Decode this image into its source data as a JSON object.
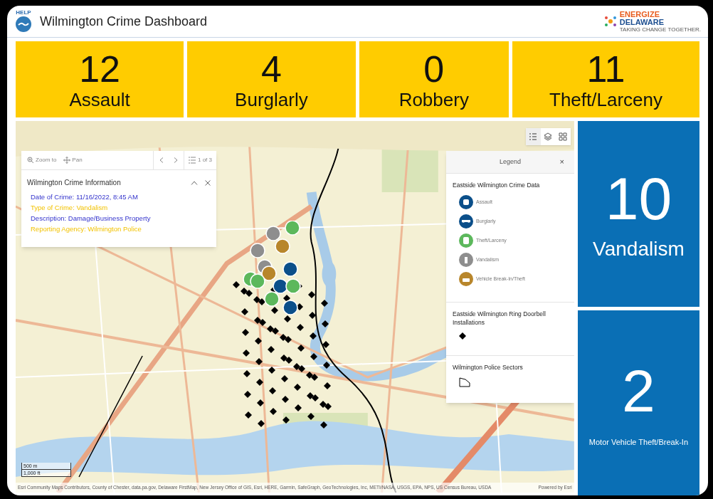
{
  "header": {
    "logo_text": "HELP",
    "title": "Wilmington Crime Dashboard",
    "brand": {
      "line1": "ENERGIZE",
      "line2": "DELAWARE",
      "tagline": "TAKING CHANGE TOGETHER."
    }
  },
  "top_tiles": [
    {
      "count": "12",
      "label": "Assault",
      "color": "#ffcc00"
    },
    {
      "count": "4",
      "label": "Burglarly",
      "color": "#ffcc00"
    },
    {
      "count": "0",
      "label": "Robbery",
      "color": "#ffcc00"
    },
    {
      "count": "11",
      "label": "Theft/Larceny",
      "color": "#ffcc00"
    }
  ],
  "side_tiles": [
    {
      "count": "10",
      "label": "Vandalism",
      "kind": "large",
      "color": "#0a6fb5"
    },
    {
      "count": "2",
      "label": "Motor Vehicle Theft/Break-In",
      "kind": "small",
      "color": "#0a6fb5"
    }
  ],
  "popup": {
    "zoom_to": "Zoom to",
    "pan": "Pan",
    "pager": "1 of 3",
    "title": "Wilmington Crime Information",
    "fields": [
      {
        "text": "Date of Crime: 11/16/2022, 8:45 AM",
        "kind": "primary"
      },
      {
        "text": "Type of Crime: Vandalism",
        "kind": "highlight"
      },
      {
        "text": "Description: Damage/Business Property",
        "kind": "primary"
      },
      {
        "text": "Reporting Agency: Wilmington Police",
        "kind": "highlight"
      }
    ]
  },
  "legend": {
    "title": "Legend",
    "close": "×",
    "sections": [
      {
        "title": "Eastside Wilmington Crime Data",
        "items": [
          {
            "kind": "assault",
            "label": "Assault"
          },
          {
            "kind": "burglary",
            "label": "Burglarly"
          },
          {
            "kind": "theft",
            "label": "Theft/Larceny"
          },
          {
            "kind": "vandalism",
            "label": "Vandalism"
          },
          {
            "kind": "vehicle",
            "label": "Vehicle Break-In/Theft"
          }
        ]
      },
      {
        "title": "Eastside Wilmington Ring Doorbell Installations",
        "items": [
          {
            "kind": "diamond"
          }
        ]
      },
      {
        "title": "Wilmington Police Sectors",
        "items": [
          {
            "kind": "polygon"
          }
        ]
      }
    ]
  },
  "scale": {
    "metric": "500 m",
    "imperial": "1,000 ft"
  },
  "attribution": "Esri Community Maps Contributors, County of Chester, data.pa.gov, Delaware FirstMap, New Jersey Office of GIS, Esri, HERE, Garmin, SafeGraph, GeoTechnologies, Inc, METI/NASA, USGS, EPA, NPS, US Census Bureau, USDA",
  "powered_by": "Powered by Esri"
}
